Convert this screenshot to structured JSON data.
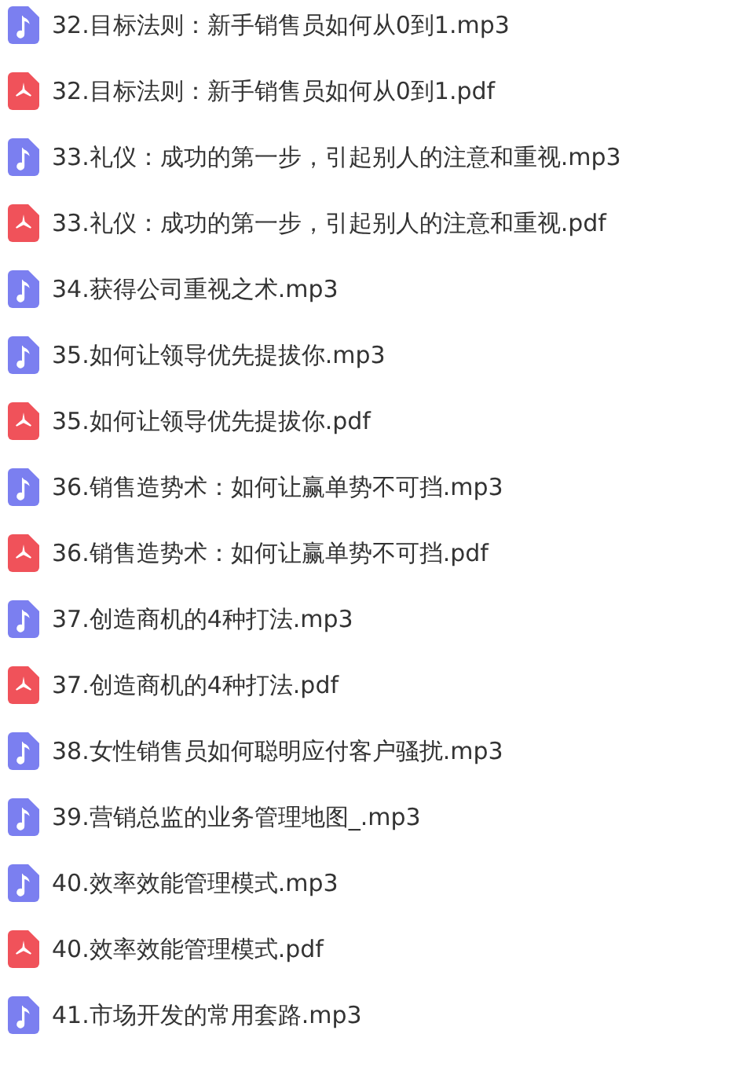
{
  "files": [
    {
      "kind": "audio",
      "name": "32.目标法则：新手销售员如何从0到1.mp3"
    },
    {
      "kind": "pdf",
      "name": "32.目标法则：新手销售员如何从0到1.pdf"
    },
    {
      "kind": "audio",
      "name": "33.礼仪：成功的第一步，引起别人的注意和重视.mp3"
    },
    {
      "kind": "pdf",
      "name": "33.礼仪：成功的第一步，引起别人的注意和重视.pdf"
    },
    {
      "kind": "audio",
      "name": "34.获得公司重视之术.mp3"
    },
    {
      "kind": "audio",
      "name": "35.如何让领导优先提拔你.mp3"
    },
    {
      "kind": "pdf",
      "name": "35.如何让领导优先提拔你.pdf"
    },
    {
      "kind": "audio",
      "name": "36.销售造势术：如何让赢单势不可挡.mp3"
    },
    {
      "kind": "pdf",
      "name": "36.销售造势术：如何让赢单势不可挡.pdf"
    },
    {
      "kind": "audio",
      "name": "37.创造商机的4种打法.mp3"
    },
    {
      "kind": "pdf",
      "name": "37.创造商机的4种打法.pdf"
    },
    {
      "kind": "audio",
      "name": "38.女性销售员如何聪明应付客户骚扰.mp3"
    },
    {
      "kind": "audio",
      "name": "39.营销总监的业务管理地图_.mp3"
    },
    {
      "kind": "audio",
      "name": "40.效率效能管理模式.mp3"
    },
    {
      "kind": "pdf",
      "name": "40.效率效能管理模式.pdf"
    },
    {
      "kind": "audio",
      "name": "41.市场开发的常用套路.mp3"
    }
  ]
}
